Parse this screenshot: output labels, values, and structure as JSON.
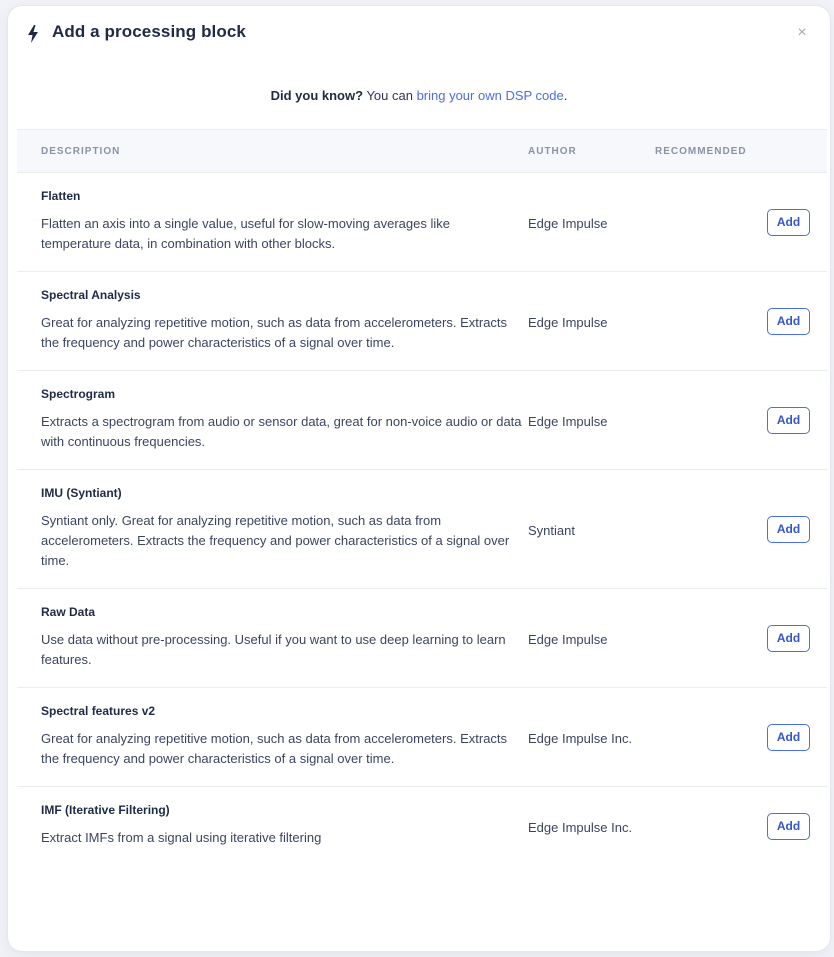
{
  "modal": {
    "title": "Add a processing block",
    "title_icon": "bolt-icon",
    "close_symbol": "×",
    "close_icon": "close-icon"
  },
  "info": {
    "prefix_bold": "Did you know?",
    "text": " You can ",
    "link_label": "bring your own DSP code",
    "suffix": "."
  },
  "table": {
    "headers": {
      "description": "DESCRIPTION",
      "author": "AUTHOR",
      "recommended": "RECOMMENDED"
    },
    "add_label": "Add",
    "rows": [
      {
        "name": "Flatten",
        "description": "Flatten an axis into a single value, useful for slow-moving averages like temperature data, in combination with other blocks.",
        "author": "Edge Impulse"
      },
      {
        "name": "Spectral Analysis",
        "description": "Great for analyzing repetitive motion, such as data from accelerometers. Extracts the frequency and power characteristics of a signal over time.",
        "author": "Edge Impulse"
      },
      {
        "name": "Spectrogram",
        "description": "Extracts a spectrogram from audio or sensor data, great for non-voice audio or data with continuous frequencies.",
        "author": "Edge Impulse"
      },
      {
        "name": "IMU (Syntiant)",
        "description": "Syntiant only. Great for analyzing repetitive motion, such as data from accelerometers. Extracts the frequency and power characteristics of a signal over time.",
        "author": "Syntiant"
      },
      {
        "name": "Raw Data",
        "description": "Use data without pre-processing. Useful if you want to use deep learning to learn features.",
        "author": "Edge Impulse"
      },
      {
        "name": "Spectral features v2",
        "description": "Great for analyzing repetitive motion, such as data from accelerometers. Extracts the frequency and power characteristics of a signal over time.",
        "author": "Edge Impulse Inc."
      },
      {
        "name": "IMF (Iterative Filtering)",
        "description": "Extract IMFs from a signal using iterative filtering",
        "author": "Edge Impulse Inc."
      }
    ]
  },
  "colors": {
    "accent": "#4b6fe4",
    "title": "#1f2a44",
    "header_bg": "#f7f8fc"
  }
}
